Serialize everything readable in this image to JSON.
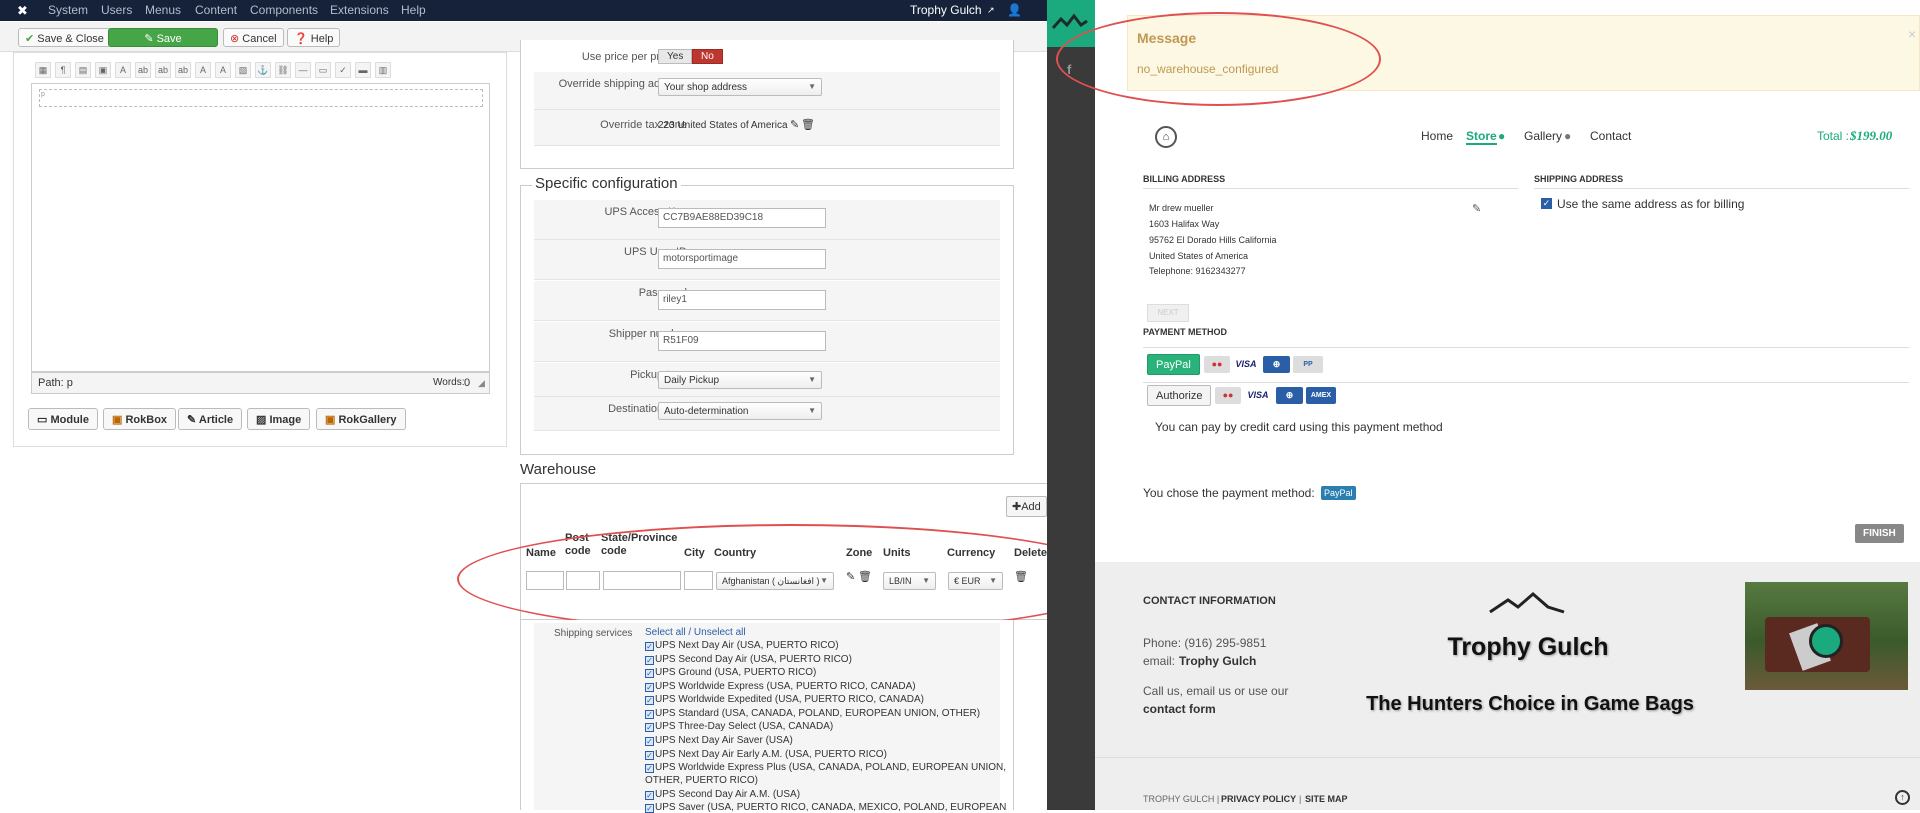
{
  "admin": {
    "menu": [
      "System",
      "Users",
      "Menus",
      "Content",
      "Components",
      "Extensions",
      "Help"
    ],
    "site_name": "Trophy Gulch",
    "toolbar": {
      "save_close": "Save & Close",
      "save": "Save",
      "cancel": "Cancel",
      "help": "Help"
    },
    "editor": {
      "placeholder_p": "p",
      "path_label": "Path: p",
      "words_label": "Words:",
      "words_count": "0",
      "buttons": [
        "Module",
        "RokBox",
        "Article",
        "Image",
        "RokGallery"
      ]
    },
    "shipping_config": {
      "use_price_label": "Use price per product",
      "yes": "Yes",
      "no": "No",
      "override_shipping_label": "Override shipping address",
      "override_shipping_value": "Your shop address",
      "override_tax_label": "Override tax zone",
      "override_tax_value": "223 United States of America"
    },
    "specific": {
      "legend": "Specific configuration",
      "ups_access_key_label": "UPS Access Key",
      "ups_access_key": "CC7B9AE88ED39C18",
      "ups_user_id_label": "UPS User ID",
      "ups_user_id": "motorsportimage",
      "password_label": "Password",
      "password": "riley1",
      "shipper_number_label": "Shipper number",
      "shipper_number": "R51F09",
      "pickup_type_label": "Pickup type",
      "pickup_type": "Daily Pickup",
      "destination_type_label": "Destination type",
      "destination_type": "Auto-determination"
    },
    "warehouse": {
      "legend": "Warehouse",
      "add": "Add",
      "headers": {
        "name": "Name",
        "post_code": "Post code",
        "state": "State/Province code",
        "city": "City",
        "country": "Country",
        "zone": "Zone",
        "units": "Units",
        "currency": "Currency",
        "delete": "Delete"
      },
      "country": "Afghanistan ( افغانستان )",
      "units": "LB/IN",
      "currency": "€ EUR"
    },
    "shipping_services": {
      "label": "Shipping services",
      "select_all": "Select all / Unselect all",
      "items": [
        "UPS Next Day Air (USA, PUERTO RICO)",
        "UPS Second Day Air (USA, PUERTO RICO)",
        "UPS Ground (USA, PUERTO RICO)",
        "UPS Worldwide Express (USA, PUERTO RICO, CANADA)",
        "UPS Worldwide Expedited (USA, PUERTO RICO, CANADA)",
        "UPS Standard (USA, CANADA, POLAND, EUROPEAN UNION, OTHER)",
        "UPS Three-Day Select (USA, CANADA)",
        "UPS Next Day Air Saver (USA)",
        "UPS Next Day Air Early A.M. (USA, PUERTO RICO)",
        "UPS Worldwide Express Plus (USA, CANADA, POLAND, EUROPEAN UNION,",
        "OTHER, PUERTO RICO)",
        "UPS Second Day Air A.M. (USA)",
        "UPS Saver (USA, PUERTO RICO, CANADA, MEXICO, POLAND, EUROPEAN"
      ]
    }
  },
  "store": {
    "message_title": "Message",
    "message_text": "no_warehouse_configured",
    "close": "×",
    "nav": {
      "home": "Home",
      "store": "Store",
      "gallery": "Gallery",
      "contact": "Contact"
    },
    "total_label": "Total :",
    "total_value": "$199.00",
    "billing_title": "BILLING ADDRESS",
    "shipping_title": "SHIPPING ADDRESS",
    "same_address": "Use the same address as for billing",
    "billing_lines": [
      "Mr drew mueller",
      "1603 Halifax Way",
      "95762 El Dorado Hills California",
      "United States of America",
      "Telephone: 9162343277"
    ],
    "next": "NEXT",
    "payment_title": "PAYMENT METHOD",
    "paypal": "PayPal",
    "authorize": "Authorize",
    "card_note": "You can pay by credit card using this payment method",
    "chose_text": "You chose the payment method:",
    "chose_badge": "PayPal",
    "finish": "FINISH",
    "footer": {
      "contact_title": "CONTACT INFORMATION",
      "phone": "Phone: (916) 295-9851",
      "email_label": "email:",
      "email_value": "Trophy Gulch",
      "call_us": "Call us, email us or use our",
      "contact_form": "contact form",
      "brand": "Trophy Gulch",
      "tagline": "The Hunters Choice in Game Bags",
      "copyright": "TROPHY GULCH |",
      "privacy": "PRIVACY POLICY",
      "sep": "|",
      "sitemap": "SITE MAP"
    }
  },
  "colors": {
    "nav_dark": "#15223a",
    "green": "#46a546",
    "store_green": "#1aaa7e",
    "annotation_red": "#e05050"
  }
}
